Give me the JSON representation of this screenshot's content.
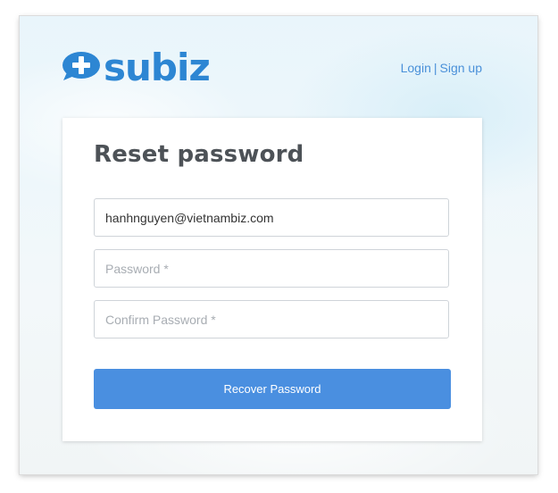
{
  "brand": {
    "logo_text": "subiz",
    "logo_icon": "chat-bubble-plus-icon",
    "color": "#2d86d3"
  },
  "header": {
    "login_label": "Login",
    "separator": "|",
    "signup_label": "Sign up"
  },
  "form": {
    "title": "Reset password",
    "email_value": "hanhnguyen@vietnambiz.com",
    "password_placeholder": "Password *",
    "confirm_placeholder": "Confirm Password *",
    "submit_label": "Recover Password",
    "accent": "#4a8fe0"
  }
}
